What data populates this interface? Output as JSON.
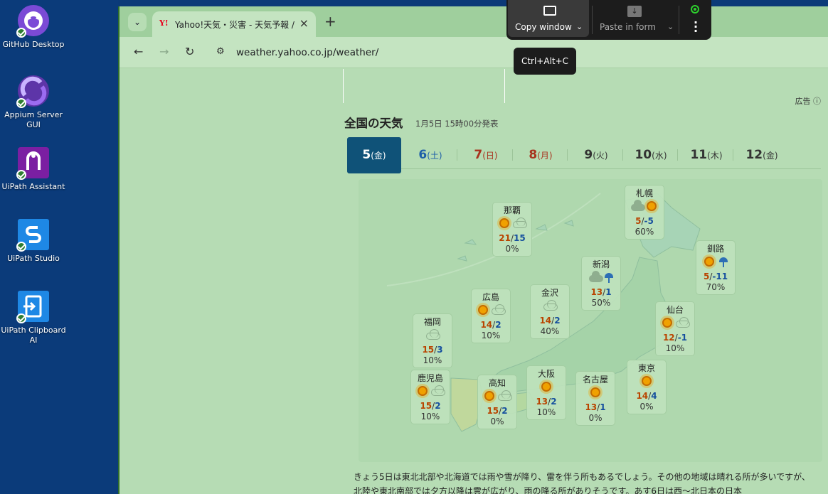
{
  "desktop": {
    "icons": [
      {
        "label": "GitHub Desktop",
        "icon": "github-icon",
        "color": "#6e3fc8"
      },
      {
        "label": "Appium Server GUI",
        "icon": "appium-icon",
        "color": "#6a3fb0"
      },
      {
        "label": "UiPath Assistant",
        "icon": "uipath-assistant-icon",
        "color": "#7b1fa2"
      },
      {
        "label": "UiPath Studio",
        "icon": "uipath-studio-icon",
        "color": "#1f8be0"
      },
      {
        "label": "UiPath Clipboard AI",
        "icon": "uipath-clipboard-icon",
        "color": "#1f8be0"
      }
    ]
  },
  "browser": {
    "tab_title": "Yahoo!天気・災害 - 天気予報 / 防",
    "tab_favicon_text": "Y!",
    "url": "weather.yahoo.co.jp/weather/"
  },
  "overlay": {
    "copy_label": "Copy window",
    "paste_label": "Paste in form",
    "tooltip": "Ctrl+Alt+C"
  },
  "page": {
    "ad_label": "広告 ⓘ",
    "section_title": "全国の天気",
    "section_date": "1月5日 15時00分発表",
    "day_tabs": [
      {
        "day": "5",
        "weekday": "(金)",
        "color": "#ffffff"
      },
      {
        "day": "6",
        "weekday": "(土)",
        "color": "#1e5fa8"
      },
      {
        "day": "7",
        "weekday": "(日)",
        "color": "#a8321e"
      },
      {
        "day": "8",
        "weekday": "(月)",
        "color": "#a8321e"
      },
      {
        "day": "9",
        "weekday": "(火)",
        "color": "#333333"
      },
      {
        "day": "10",
        "weekday": "(水)",
        "color": "#333333"
      },
      {
        "day": "11",
        "weekday": "(木)",
        "color": "#333333"
      },
      {
        "day": "12",
        "weekday": "(金)",
        "color": "#333333"
      }
    ],
    "cities": [
      {
        "name": "札幌",
        "high": "5",
        "low": "-5",
        "pop": "60%",
        "weather": "cloud-sun-icon"
      },
      {
        "name": "那覇",
        "high": "21",
        "low": "15",
        "pop": "0%",
        "weather": "sun-cloud-icon"
      },
      {
        "name": "釧路",
        "high": "5",
        "low": "-11",
        "pop": "70%",
        "weather": "sun-rain-icon"
      },
      {
        "name": "新潟",
        "high": "13",
        "low": "1",
        "pop": "50%",
        "weather": "cloud-rain-icon"
      },
      {
        "name": "広島",
        "high": "14",
        "low": "2",
        "pop": "10%",
        "weather": "sun-cloud-icon"
      },
      {
        "name": "金沢",
        "high": "14",
        "low": "2",
        "pop": "40%",
        "weather": "cloud-icon"
      },
      {
        "name": "仙台",
        "high": "12",
        "low": "-1",
        "pop": "10%",
        "weather": "sun-cloud-icon"
      },
      {
        "name": "福岡",
        "high": "15",
        "low": "3",
        "pop": "10%",
        "weather": "cloud-icon"
      },
      {
        "name": "鹿児島",
        "high": "15",
        "low": "2",
        "pop": "10%",
        "weather": "sun-cloud-icon"
      },
      {
        "name": "高知",
        "high": "15",
        "low": "2",
        "pop": "0%",
        "weather": "sun-cloud-icon"
      },
      {
        "name": "大阪",
        "high": "13",
        "low": "2",
        "pop": "10%",
        "weather": "sun-icon"
      },
      {
        "name": "名古屋",
        "high": "13",
        "low": "1",
        "pop": "0%",
        "weather": "sun-icon"
      },
      {
        "name": "東京",
        "high": "14",
        "low": "4",
        "pop": "0%",
        "weather": "sun-icon"
      }
    ],
    "forecast_text": "きょう5日は東北北部や北海道では雨や雪が降り、雷を伴う所もあるでしょう。その他の地域は晴れる所が多いですが、北陸や東北南部では夕方以降は雲が広がり、雨の降る所がありそうです。あす6日は西～北日本の日本"
  }
}
